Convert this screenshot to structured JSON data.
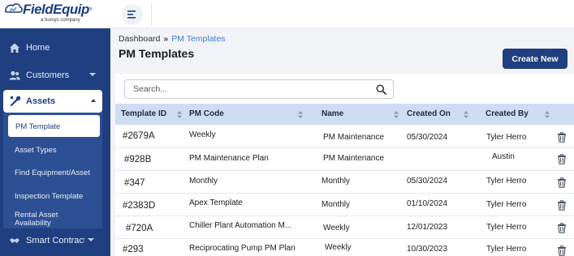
{
  "brand": {
    "name": "FieldEquip",
    "tm": "®",
    "tagline": "a bursys company",
    "colors": {
      "primary": "#1f3f80",
      "accent": "#3f7fd1",
      "header_row": "#cfdcf3"
    }
  },
  "topbar": {
    "menu_icon": "menu-lines-icon"
  },
  "sidebar": {
    "items": [
      {
        "label": "Home",
        "icon": "home-icon"
      },
      {
        "label": "Customers",
        "icon": "users-icon"
      },
      {
        "label": "Assets",
        "icon": "tools-icon"
      },
      {
        "label": "Smart Contracts",
        "icon": "handshake-icon"
      }
    ],
    "asset_submenu": [
      {
        "label": "PM Template"
      },
      {
        "label": "Asset Types"
      },
      {
        "label": "Find Equipment/Asset"
      },
      {
        "label": "Inspection Template"
      },
      {
        "label": "Rental Asset Availability"
      }
    ]
  },
  "breadcrumb": {
    "home": "Dashboard",
    "separator": "»",
    "current": "PM Templates"
  },
  "page": {
    "title": "PM Templates",
    "create_label": "Create New"
  },
  "search": {
    "placeholder": "Search..."
  },
  "table": {
    "columns": [
      "Template ID",
      "PM Code",
      "Name",
      "Created On",
      "Created By"
    ],
    "rows": [
      {
        "id": "#2679A",
        "code": "Weekly",
        "name": "PM Maintenance",
        "created_on": "05/30/2024",
        "created_by": "Tyler Herro"
      },
      {
        "id": "#928B",
        "code": "PM Maintenance Plan",
        "name": "PM Maintenance",
        "created_on": "",
        "created_by": "Austin"
      },
      {
        "id": "#347",
        "code": "Monthly",
        "name": "Monthly",
        "created_on": "05/30/2024",
        "created_by": "Tyler Herro"
      },
      {
        "id": "#2383D",
        "code": "Apex Template",
        "name": "Monthly",
        "created_on": "01/10/2024",
        "created_by": "Tyler Herro"
      },
      {
        "id": "#720A",
        "code": "Chiller Plant Automation M...",
        "name": "Weekly",
        "created_on": "12/01/2023",
        "created_by": "Tyler Herro"
      },
      {
        "id": "#293",
        "code": "Reciprocating Pump PM Plan",
        "name": "Weekly",
        "created_on": "10/30/2023",
        "created_by": "Tyler Herro"
      }
    ]
  }
}
